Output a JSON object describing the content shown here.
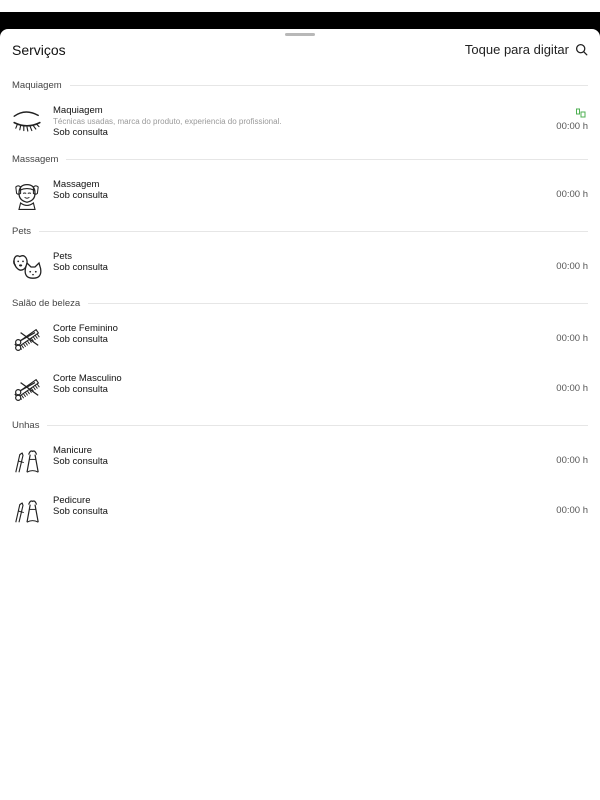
{
  "header": {
    "title": "Serviços",
    "search_label": "Toque para digitar"
  },
  "sections": [
    {
      "label": "Maquiagem",
      "items": [
        {
          "name": "Maquiagem",
          "description": "Técnicas usadas, marca do produto, experiencia do profissional.",
          "price": "Sob consulta",
          "duration": "00:00 h",
          "icon": "eyelash-icon"
        }
      ]
    },
    {
      "label": "Massagem",
      "items": [
        {
          "name": "Massagem",
          "price": "Sob consulta",
          "duration": "00:00 h",
          "icon": "massage-face-icon"
        }
      ]
    },
    {
      "label": "Pets",
      "items": [
        {
          "name": "Pets",
          "price": "Sob consulta",
          "duration": "00:00 h",
          "icon": "dog-cat-icon"
        }
      ]
    },
    {
      "label": "Salão de beleza",
      "items": [
        {
          "name": "Corte Feminino",
          "price": "Sob consulta",
          "duration": "00:00 h",
          "icon": "scissors-comb-icon"
        },
        {
          "name": "Corte Masculino",
          "price": "Sob consulta",
          "duration": "00:00 h",
          "icon": "scissors-comb-icon"
        }
      ]
    },
    {
      "label": "Unhas",
      "items": [
        {
          "name": "Manicure",
          "price": "Sob consulta",
          "duration": "00:00 h",
          "icon": "nail-clippers-icon"
        },
        {
          "name": "Pedicure",
          "price": "Sob consulta",
          "duration": "00:00 h",
          "icon": "nail-clippers-icon"
        }
      ]
    }
  ],
  "colors": {
    "badge_green": "#4caf50",
    "divider": "#e6e6e6"
  }
}
